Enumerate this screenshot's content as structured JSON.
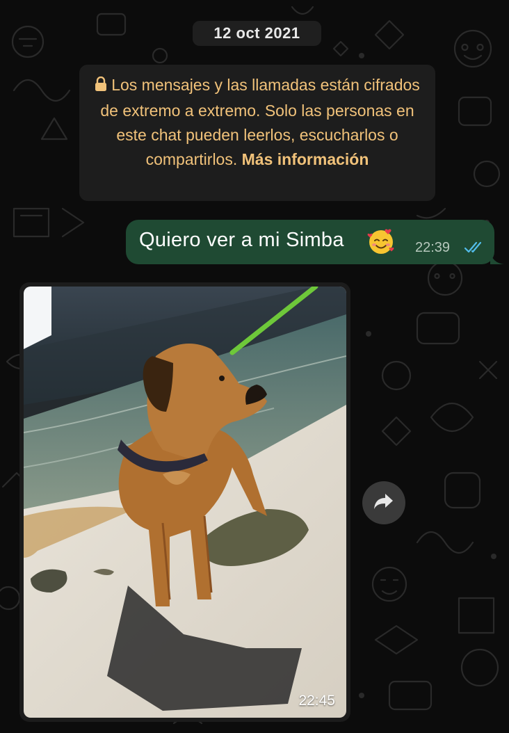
{
  "chat": {
    "date_label": "12 oct 2021",
    "encryption_notice": {
      "text": "Los mensajes y las llamadas están cifrados de extremo a extremo. Solo las personas en este chat pueden leerlos, escucharlos o compartirlos.",
      "link_label": "Más información",
      "icon": "lock-icon"
    },
    "messages": [
      {
        "direction": "outgoing",
        "text": "Quiero ver a mi Simba",
        "emoji": "smiling-face-with-hearts",
        "time": "22:39",
        "status": "read",
        "status_icon": "double-check-icon"
      },
      {
        "direction": "incoming",
        "type": "image",
        "image_description_icon": "photo",
        "time": "22:45",
        "action_icon": "forward-icon"
      }
    ]
  },
  "colors": {
    "background": "#0c0c0c",
    "notice_text": "#f1c27a",
    "outgoing_bubble": "#1f4a33",
    "read_check": "#53bdeb"
  }
}
